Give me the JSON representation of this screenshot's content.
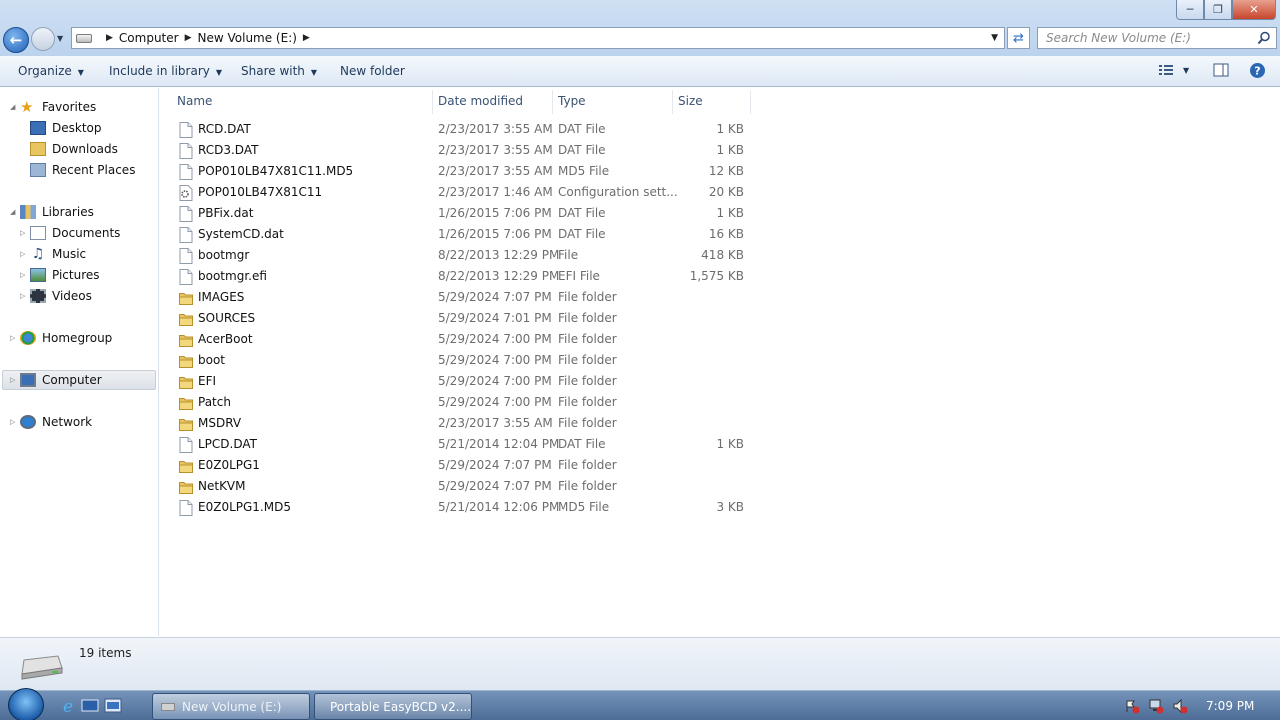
{
  "window": {
    "controls": {
      "minimize": "─",
      "maximize": "❐",
      "close": "✕"
    }
  },
  "address": {
    "crumbs": [
      "Computer",
      "New Volume (E:)"
    ]
  },
  "search": {
    "placeholder": "Search New Volume (E:)"
  },
  "toolbar": {
    "organize": "Organize",
    "include_in_library": "Include in library",
    "share_with": "Share with",
    "new_folder": "New folder"
  },
  "nav": {
    "favorites": "Favorites",
    "desktop": "Desktop",
    "downloads": "Downloads",
    "recent_places": "Recent Places",
    "libraries": "Libraries",
    "documents": "Documents",
    "music": "Music",
    "pictures": "Pictures",
    "videos": "Videos",
    "homegroup": "Homegroup",
    "computer": "Computer",
    "network": "Network"
  },
  "columns": {
    "name": "Name",
    "date": "Date modified",
    "type": "Type",
    "size": "Size"
  },
  "files": [
    {
      "name": "RCD.DAT",
      "date": "2/23/2017 3:55 AM",
      "type": "DAT File",
      "size": "1 KB",
      "icon": "file"
    },
    {
      "name": "RCD3.DAT",
      "date": "2/23/2017 3:55 AM",
      "type": "DAT File",
      "size": "1 KB",
      "icon": "file"
    },
    {
      "name": "POP010LB47X81C11.MD5",
      "date": "2/23/2017 3:55 AM",
      "type": "MD5 File",
      "size": "12 KB",
      "icon": "file"
    },
    {
      "name": "POP010LB47X81C11",
      "date": "2/23/2017 1:46 AM",
      "type": "Configuration sett...",
      "size": "20 KB",
      "icon": "config"
    },
    {
      "name": "PBFix.dat",
      "date": "1/26/2015 7:06 PM",
      "type": "DAT File",
      "size": "1 KB",
      "icon": "file"
    },
    {
      "name": "SystemCD.dat",
      "date": "1/26/2015 7:06 PM",
      "type": "DAT File",
      "size": "16 KB",
      "icon": "file"
    },
    {
      "name": "bootmgr",
      "date": "8/22/2013 12:29 PM",
      "type": "File",
      "size": "418 KB",
      "icon": "file"
    },
    {
      "name": "bootmgr.efi",
      "date": "8/22/2013 12:29 PM",
      "type": "EFI File",
      "size": "1,575 KB",
      "icon": "file"
    },
    {
      "name": "IMAGES",
      "date": "5/29/2024 7:07 PM",
      "type": "File folder",
      "size": "",
      "icon": "folder"
    },
    {
      "name": "SOURCES",
      "date": "5/29/2024 7:01 PM",
      "type": "File folder",
      "size": "",
      "icon": "folder"
    },
    {
      "name": "AcerBoot",
      "date": "5/29/2024 7:00 PM",
      "type": "File folder",
      "size": "",
      "icon": "folder"
    },
    {
      "name": "boot",
      "date": "5/29/2024 7:00 PM",
      "type": "File folder",
      "size": "",
      "icon": "folder"
    },
    {
      "name": "EFI",
      "date": "5/29/2024 7:00 PM",
      "type": "File folder",
      "size": "",
      "icon": "folder"
    },
    {
      "name": "Patch",
      "date": "5/29/2024 7:00 PM",
      "type": "File folder",
      "size": "",
      "icon": "folder"
    },
    {
      "name": "MSDRV",
      "date": "2/23/2017 3:55 AM",
      "type": "File folder",
      "size": "",
      "icon": "folder"
    },
    {
      "name": "LPCD.DAT",
      "date": "5/21/2014 12:04 PM",
      "type": "DAT File",
      "size": "1 KB",
      "icon": "file"
    },
    {
      "name": "E0Z0LPG1",
      "date": "5/29/2024 7:07 PM",
      "type": "File folder",
      "size": "",
      "icon": "folder"
    },
    {
      "name": "NetKVM",
      "date": "5/29/2024 7:07 PM",
      "type": "File folder",
      "size": "",
      "icon": "folder"
    },
    {
      "name": "E0Z0LPG1.MD5",
      "date": "5/21/2014 12:06 PM",
      "type": "MD5 File",
      "size": "3 KB",
      "icon": "file"
    }
  ],
  "status": {
    "item_count": "19 items"
  },
  "taskbar": {
    "windows": [
      "New Volume (E:)",
      "Portable EasyBCD v2...."
    ],
    "clock": "7:09 PM"
  },
  "colors": {
    "accent": "#1f5fb8",
    "folder": "#e8c560",
    "header_text": "#3b5273"
  }
}
